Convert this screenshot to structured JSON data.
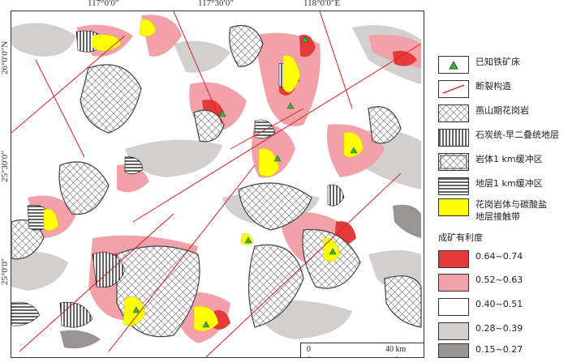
{
  "map": {
    "top_ticks": [
      "117°0′0″",
      "117°30′0″",
      "118°0′0″E"
    ],
    "left_ticks": [
      "26°0′0″N",
      "25°30′0″",
      "25°0′0″"
    ],
    "scale": {
      "start": "0",
      "end": "40 km"
    }
  },
  "legend": {
    "items": [
      {
        "label": "已知铁矿床",
        "icon": "green-triangle-icon"
      },
      {
        "label": "断裂构造",
        "icon": "red-line-icon"
      },
      {
        "label": "燕山期花岗岩",
        "icon": "crosshatch-pattern"
      },
      {
        "label": "石炭统-早二叠统地层",
        "icon": "vertical-stripe-pattern"
      },
      {
        "label": "岩体1 km缓冲区",
        "icon": "dense-crosshatch-pattern"
      },
      {
        "label": "地层1 km缓冲区",
        "icon": "horizontal-stripe-pattern"
      },
      {
        "label": "花岗岩体与碳酸盐\n地层接触带",
        "color": "#ffff00"
      }
    ],
    "favorability_title": "成矿有利度",
    "favorability": [
      {
        "label": "0.64~0.74",
        "color": "#e53a3a"
      },
      {
        "label": "0.52~0.63",
        "color": "#f2a1a8"
      },
      {
        "label": "0.40~0.51",
        "color": "#ffffff"
      },
      {
        "label": "0.28~0.39",
        "color": "#d2cfcf"
      },
      {
        "label": "0.15~0.27",
        "color": "#9a9595"
      }
    ]
  }
}
